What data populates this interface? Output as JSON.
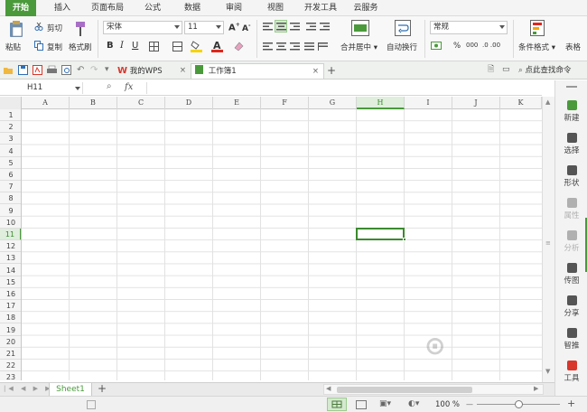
{
  "menu": {
    "tabs": [
      {
        "label": "开始",
        "active": true
      },
      {
        "label": "插入"
      },
      {
        "label": "页面布局"
      },
      {
        "label": "公式"
      },
      {
        "label": "数据"
      },
      {
        "label": "审阅"
      },
      {
        "label": "视图"
      },
      {
        "label": "开发工具"
      },
      {
        "label": "云服务"
      }
    ]
  },
  "ribbon": {
    "paste": "粘贴",
    "cut": "剪切",
    "copy": "复制",
    "format_painter": "格式刷",
    "font_name": "宋体",
    "font_size": "11",
    "merge_center": "合并居中",
    "wrap_text": "自动换行",
    "number_format": "常规",
    "percent": "%",
    "thousands": "000",
    "conditional_format": "条件格式",
    "table_style": "表格"
  },
  "tabs": {
    "wps": "我的WPS",
    "workbook": "工作簿1",
    "search": "点此查找命令"
  },
  "formula_bar": {
    "name_box": "H11",
    "fx": "fx",
    "value": ""
  },
  "grid": {
    "columns": [
      "A",
      "B",
      "C",
      "D",
      "E",
      "F",
      "G",
      "H",
      "I",
      "J",
      "K"
    ],
    "selected_column": "H",
    "rows": [
      "1",
      "2",
      "3",
      "4",
      "5",
      "6",
      "7",
      "8",
      "9",
      "10",
      "11",
      "12",
      "13",
      "14",
      "15",
      "16",
      "17",
      "18",
      "19",
      "20",
      "21",
      "22",
      "23"
    ],
    "selected_row": "11",
    "active_cell": "H11"
  },
  "right_panel": [
    {
      "label": "新建",
      "icon": "new-icon",
      "color": "#4a9a3b"
    },
    {
      "label": "选择",
      "icon": "select-icon",
      "color": "#555555"
    },
    {
      "label": "形状",
      "icon": "shapes-icon",
      "color": "#555555"
    },
    {
      "label": "属性",
      "icon": "properties-icon",
      "color": "#b0b0b0"
    },
    {
      "label": "分析",
      "icon": "analyze-icon",
      "color": "#b0b0b0"
    },
    {
      "label": "传图",
      "icon": "upload-image-icon",
      "color": "#555555"
    },
    {
      "label": "分享",
      "icon": "share-icon",
      "color": "#555555"
    },
    {
      "label": "智推",
      "icon": "recommend-icon",
      "color": "#555555"
    },
    {
      "label": "工具",
      "icon": "tools-icon",
      "color": "#d9362b"
    }
  ],
  "sheets": {
    "active": "Sheet1",
    "add": "+"
  },
  "status": {
    "zoom": "100 %",
    "zoom_minus": "—",
    "zoom_plus": "+"
  },
  "colors": {
    "accent": "#4a9a3b",
    "menu_bg": "#f4f4f4",
    "header_bg": "#f5f5f5"
  }
}
